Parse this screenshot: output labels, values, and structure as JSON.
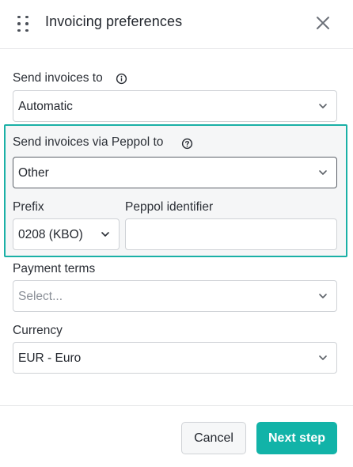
{
  "header": {
    "title": "Invoicing preferences"
  },
  "send_invoices": {
    "label": "Send invoices to",
    "value": "Automatic"
  },
  "peppol": {
    "label": "Send invoices via Peppol to",
    "value": "Other",
    "prefix_label": "Prefix",
    "prefix_value": "0208 (KBO)",
    "identifier_label": "Peppol identifier",
    "identifier_value": ""
  },
  "payment_terms": {
    "label": "Payment terms",
    "placeholder": "Select..."
  },
  "currency": {
    "label": "Currency",
    "value": "EUR - Euro"
  },
  "footer": {
    "cancel_label": "Cancel",
    "next_label": "Next step"
  },
  "colors": {
    "accent": "#12b3a8",
    "highlight_border": "#1ab0a6"
  }
}
